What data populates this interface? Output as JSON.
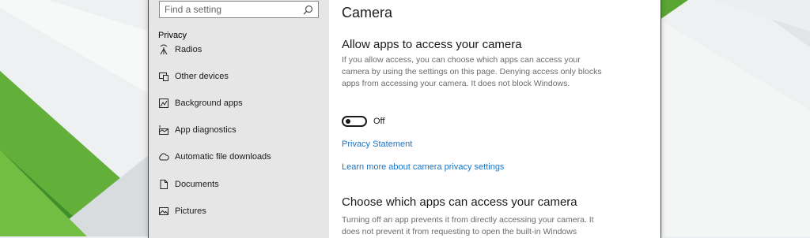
{
  "search": {
    "placeholder": "Find a setting"
  },
  "sidebar": {
    "section_title": "Privacy",
    "items": [
      {
        "label": "Radios",
        "icon": "radio-tower-icon"
      },
      {
        "label": "Other devices",
        "icon": "devices-icon"
      },
      {
        "label": "Background apps",
        "icon": "background-apps-icon"
      },
      {
        "label": "App diagnostics",
        "icon": "diagnostics-icon"
      },
      {
        "label": "Automatic file downloads",
        "icon": "cloud-icon"
      },
      {
        "label": "Documents",
        "icon": "document-icon"
      },
      {
        "label": "Pictures",
        "icon": "picture-icon"
      }
    ]
  },
  "content": {
    "title": "Camera",
    "allow_heading": "Allow apps to access your camera",
    "allow_description": "If you allow access, you can choose which apps can access your camera by using the settings on this page. Denying access only blocks apps from accessing your camera. It does not block Windows.",
    "toggle_state": "Off",
    "privacy_statement_link": "Privacy Statement",
    "learn_more_link": "Learn more about camera privacy settings",
    "choose_heading": "Choose which apps can access your camera",
    "choose_description": "Turning off an app prevents it from directly accessing your camera. It does not prevent it from requesting to open the built-in Windows"
  },
  "colors": {
    "accent_link": "#1a73c4",
    "sidebar_bg": "#e6e6e6",
    "wallpaper_green": "#5aa632"
  }
}
